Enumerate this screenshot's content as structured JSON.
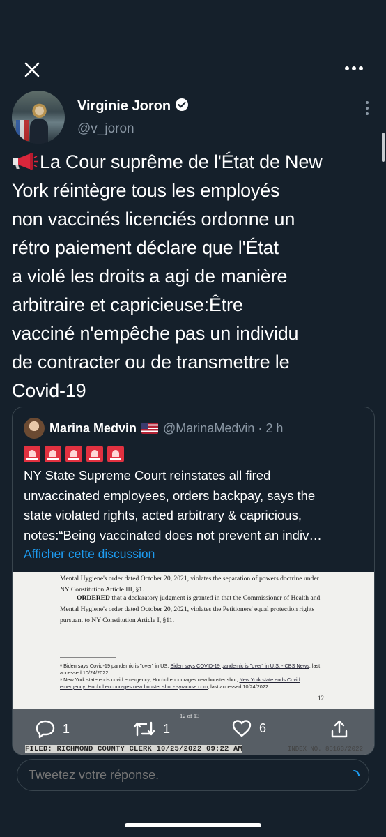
{
  "author": {
    "name": "Virginie Joron",
    "handle": "@v_joron"
  },
  "tweet": {
    "lines": [
      "La Cour suprême de l'État de New",
      "York réintègre tous les employés",
      "non vaccinés licenciés ordonne un",
      "rétro paiement déclare que l'État",
      "a violé les droits a agi de manière",
      "arbitraire et capricieuse:Être",
      "vacciné n'empêche pas un individu",
      "de contracter ou de transmettre le",
      "Covid-19"
    ]
  },
  "quoted": {
    "name": "Marina Medvin",
    "handle_time": "@MarinaMedvin · 2 h",
    "text_lines": [
      "NY State Supreme Court reinstates all fired",
      "unvaccinated employees, orders backpay, says the",
      "state violated rights, acted arbitrary & capricious,",
      "notes:“Being vaccinated does not prevent an indiv…"
    ],
    "show_thread": "Afficher cette discussion"
  },
  "document": {
    "p1": "Mental Hygiene's order dated October 20, 2021, violates the separation of powers doctrine under",
    "p2": "NY Constitution Article III, §1.",
    "p3_bold": "ORDERED",
    "p3_rest": " that a declaratory judgment is granted in that the Commissioner of Health and",
    "p4": "Mental Hygiene's order dated October 20, 2021, violates the Petitioners' equal protection rights",
    "p5": "pursuant to NY Constitution Article I, §11.",
    "fn1_a": "⁸ Biden says Covid-19 pandemic is \"over\" in US. ",
    "fn1_link": "Biden says COVID-19 pandemic is \"over\" in U.S. - CBS News",
    "fn1_b": ", last",
    "fn2": "accessed 10/24/2022.",
    "fn3_a": "⁹ New York state ends covid emergency; Hochul encourages new booster shot, ",
    "fn3_link": "New York state ends Covid",
    "fn4_link": "emergency; Hochul encourages new booster shot - syracuse.com",
    "fn4_b": ", last accessed 10/24/2022.",
    "page_num": "12",
    "page_of": "12 of 13",
    "filed": "FILED: RICHMOND COUNTY CLERK 10/25/2022 09:22 AM",
    "index": "INDEX NO. 85163/2022"
  },
  "actions": {
    "reply_count": "1",
    "retweet_count": "1",
    "like_count": "6"
  },
  "reply": {
    "placeholder": "Tweetez votre réponse."
  },
  "colors": {
    "background": "#15202b",
    "accent": "#1d9bf0",
    "muted": "#8b98a5",
    "border": "#38444d"
  }
}
